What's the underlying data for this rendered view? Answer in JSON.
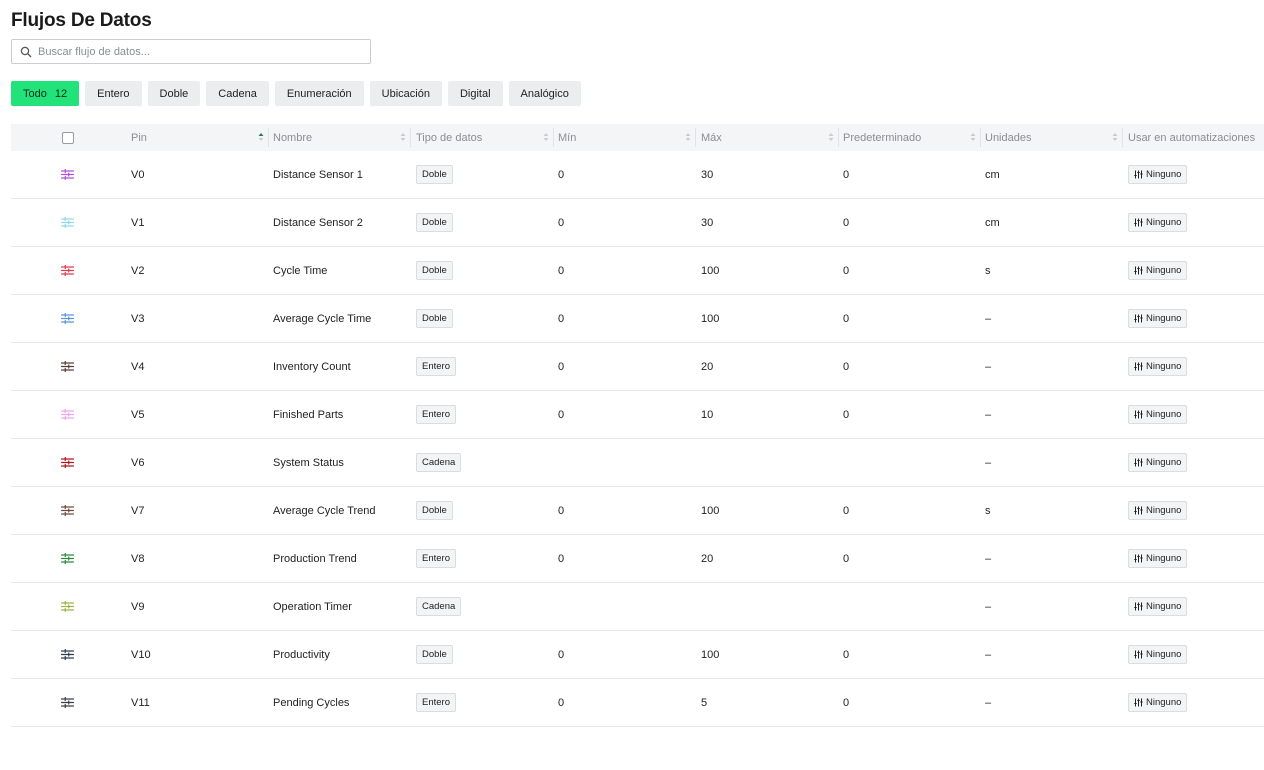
{
  "page": {
    "title": "Flujos De Datos"
  },
  "search": {
    "placeholder": "Buscar flujo de datos..."
  },
  "filters": [
    {
      "label": "Todo",
      "count": "12",
      "active": true
    },
    {
      "label": "Entero"
    },
    {
      "label": "Doble"
    },
    {
      "label": "Cadena"
    },
    {
      "label": "Enumeración"
    },
    {
      "label": "Ubicación"
    },
    {
      "label": "Digital"
    },
    {
      "label": "Analógico"
    }
  ],
  "columns": {
    "pin": "Pin",
    "nombre": "Nombre",
    "tipo": "Tipo de datos",
    "min": "Mín",
    "max": "Máx",
    "pred": "Predeterminado",
    "unidades": "Unidades",
    "auto": "Usar en automatizaciones"
  },
  "rows": [
    {
      "color": "#b04fd6",
      "pin": "V0",
      "name": "Distance Sensor 1",
      "type": "Doble",
      "min": "0",
      "max": "30",
      "def": "0",
      "units": "cm",
      "auto": "Ninguno"
    },
    {
      "color": "#8fd9e6",
      "pin": "V1",
      "name": "Distance Sensor 2",
      "type": "Doble",
      "min": "0",
      "max": "30",
      "def": "0",
      "units": "cm",
      "auto": "Ninguno"
    },
    {
      "color": "#e0394a",
      "pin": "V2",
      "name": "Cycle Time",
      "type": "Doble",
      "min": "0",
      "max": "100",
      "def": "0",
      "units": "s",
      "auto": "Ninguno"
    },
    {
      "color": "#5b93d6",
      "pin": "V3",
      "name": "Average Cycle Time",
      "type": "Doble",
      "min": "0",
      "max": "100",
      "def": "0",
      "units": "–",
      "auto": "Ninguno"
    },
    {
      "color": "#5a3b35",
      "pin": "V4",
      "name": "Inventory Count",
      "type": "Entero",
      "min": "0",
      "max": "20",
      "def": "0",
      "units": "–",
      "auto": "Ninguno"
    },
    {
      "color": "#e9a6ea",
      "pin": "V5",
      "name": "Finished Parts",
      "type": "Entero",
      "min": "0",
      "max": "10",
      "def": "0",
      "units": "–",
      "auto": "Ninguno"
    },
    {
      "color": "#b4161f",
      "pin": "V6",
      "name": "System Status",
      "type": "Cadena",
      "min": "",
      "max": "",
      "def": "",
      "units": "–",
      "auto": "Ninguno"
    },
    {
      "color": "#6e4a40",
      "pin": "V7",
      "name": "Average Cycle Trend",
      "type": "Doble",
      "min": "0",
      "max": "100",
      "def": "0",
      "units": "s",
      "auto": "Ninguno"
    },
    {
      "color": "#2e8b3c",
      "pin": "V8",
      "name": "Production Trend",
      "type": "Entero",
      "min": "0",
      "max": "20",
      "def": "0",
      "units": "–",
      "auto": "Ninguno"
    },
    {
      "color": "#9ab547",
      "pin": "V9",
      "name": "Operation Timer",
      "type": "Cadena",
      "min": "",
      "max": "",
      "def": "",
      "units": "–",
      "auto": "Ninguno"
    },
    {
      "color": "#2c3a4f",
      "pin": "V10",
      "name": "Productivity",
      "type": "Doble",
      "min": "0",
      "max": "100",
      "def": "0",
      "units": "–",
      "auto": "Ninguno"
    },
    {
      "color": "#3a3f47",
      "pin": "V11",
      "name": "Pending Cycles",
      "type": "Entero",
      "min": "0",
      "max": "5",
      "def": "0",
      "units": "–",
      "auto": "Ninguno"
    }
  ]
}
